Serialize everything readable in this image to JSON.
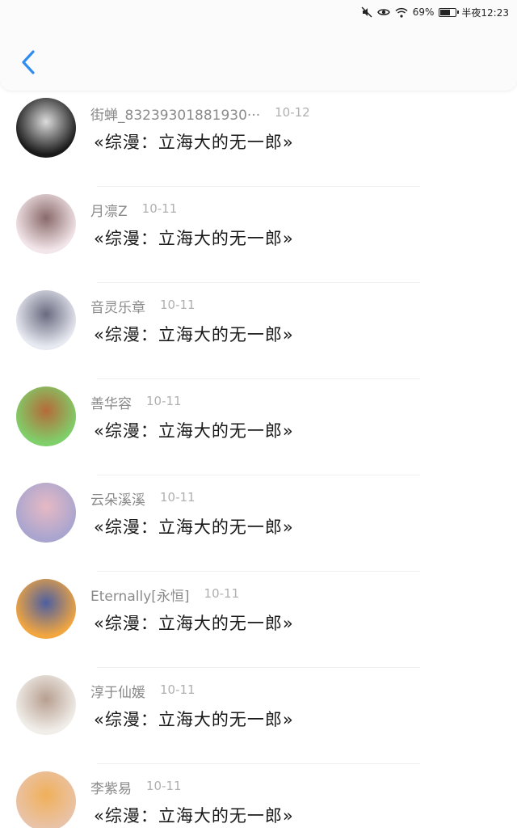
{
  "status_bar": {
    "battery": "69%",
    "battery_level": 0.69,
    "time": "半夜12:23",
    "icons": [
      "mute-icon",
      "eye-icon",
      "wifi-icon",
      "battery-icon"
    ]
  },
  "header": {
    "back_icon": "chevron-left-icon",
    "accent": "#2f8cf0"
  },
  "comments": [
    {
      "name": "街蝉_83239301881930···",
      "date": "10-12",
      "message": "«综漫：立海大的无一郎»",
      "avatar_colors": [
        "#1a1a1a",
        "#dcdcdc"
      ]
    },
    {
      "name": "月凛Z",
      "date": "10-11",
      "message": "«综漫：立海大的无一郎»",
      "avatar_colors": [
        "#f3e6ea",
        "#8a6a6a"
      ]
    },
    {
      "name": "音灵乐章",
      "date": "10-11",
      "message": "«综漫：立海大的无一郎»",
      "avatar_colors": [
        "#e8eaf2",
        "#6a6a80"
      ]
    },
    {
      "name": "善华容",
      "date": "10-11",
      "message": "«综漫：立海大的无一郎»",
      "avatar_colors": [
        "#7fd06a",
        "#b56a3a"
      ]
    },
    {
      "name": "云朵溪溪",
      "date": "10-11",
      "message": "«综漫：立海大的无一郎»",
      "avatar_colors": [
        "#a9a5cf",
        "#e6b9c4"
      ]
    },
    {
      "name": "Eternally[永恒]",
      "date": "10-11",
      "message": "«综漫：立海大的无一郎»",
      "avatar_colors": [
        "#f2a640",
        "#4d5fa0"
      ]
    },
    {
      "name": "淳于仙媛",
      "date": "10-11",
      "message": "«综漫：立海大的无一郎»",
      "avatar_colors": [
        "#f1eeea",
        "#b79f90"
      ]
    },
    {
      "name": "李紫易",
      "date": "10-11",
      "message": "«综漫：立海大的无一郎»",
      "avatar_colors": [
        "#e9c3a8",
        "#f0b05a"
      ]
    }
  ]
}
